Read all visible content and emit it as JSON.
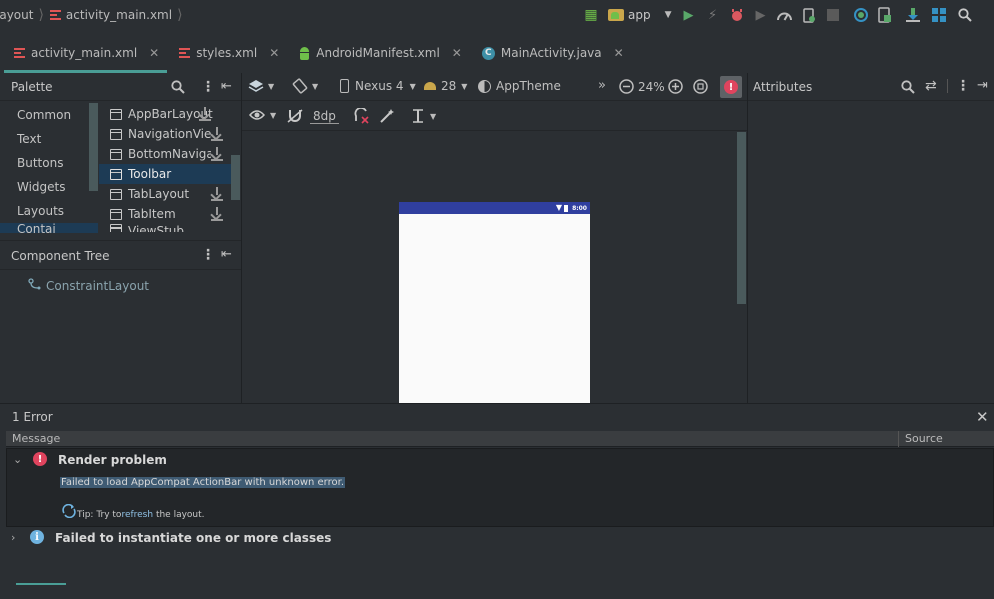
{
  "breadcrumb": {
    "item1": "layout",
    "item2": "activity_main.xml"
  },
  "run_config": {
    "module": "app"
  },
  "tabs": [
    {
      "label": "activity_main.xml",
      "icon": "xml-layout-icon",
      "active": true
    },
    {
      "label": "styles.xml",
      "icon": "xml-layout-icon",
      "active": false
    },
    {
      "label": "AndroidManifest.xml",
      "icon": "android-icon",
      "active": false
    },
    {
      "label": "MainActivity.java",
      "icon": "class-icon",
      "active": false
    }
  ],
  "palette": {
    "title": "Palette",
    "categories": [
      "Common",
      "Text",
      "Buttons",
      "Widgets",
      "Layouts",
      "Contai"
    ],
    "widgets": [
      "AppBarLayout",
      "NavigationView",
      "BottomNavigat",
      "Toolbar",
      "TabLayout",
      "TabItem",
      "ViewStub"
    ],
    "selected_widget": "Toolbar"
  },
  "component_tree": {
    "title": "Component Tree",
    "root": "ConstraintLayout"
  },
  "design_toolbar": {
    "device": "Nexus 4",
    "api": "28",
    "theme": "AppTheme",
    "zoom": "24%",
    "margin": "8dp",
    "overflow": "»"
  },
  "device_preview": {
    "status_time": "8:00",
    "status_bar_color": "#303f9f"
  },
  "attributes": {
    "title": "Attributes"
  },
  "errors": {
    "count_label": "1 Error",
    "columns": {
      "message": "Message",
      "source": "Source"
    },
    "items": [
      {
        "title": "Render problem",
        "detail": "Failed to load AppCompat ActionBar with unknown error.",
        "tip_prefix": "Tip: Try to ",
        "tip_link": "refresh",
        "tip_suffix": " the layout."
      },
      {
        "title": "Failed to instantiate one or more classes"
      }
    ]
  },
  "colors": {
    "accent": "#4a9e96",
    "error": "#e0445e",
    "info": "#6fb3e0",
    "selection": "#1d3b55"
  }
}
